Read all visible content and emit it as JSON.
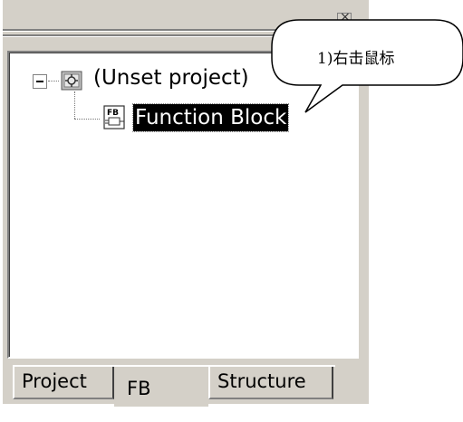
{
  "tree": {
    "root_label": "(Unset project)",
    "child_label": "Function Block",
    "child_icon_text": "FB"
  },
  "tabs": [
    {
      "label": "Project"
    },
    {
      "label": "FB"
    },
    {
      "label": "Structure"
    }
  ],
  "callout": {
    "text": "1)右击鼠标"
  }
}
